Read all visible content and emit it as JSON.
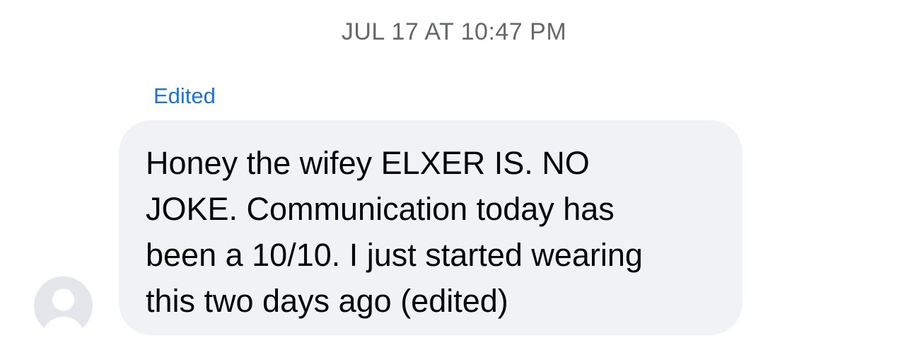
{
  "header": {
    "timestamp": "JUL 17 AT 10:47 PM"
  },
  "message": {
    "edited_label": "Edited",
    "text": "Honey the wifey ELXER IS. NO\nJOKE. Communication today has\nbeen a 10/10. I just started wearing\nthis two days ago (edited)",
    "avatar_icon": "default-profile-icon"
  },
  "colors": {
    "timestamp": "#65676b",
    "edited_label": "#1a73d9",
    "bubble_background": "#f1f2f6",
    "message_text": "#050505",
    "avatar_background": "#e4e6eb",
    "avatar_silhouette": "#ffffff"
  }
}
